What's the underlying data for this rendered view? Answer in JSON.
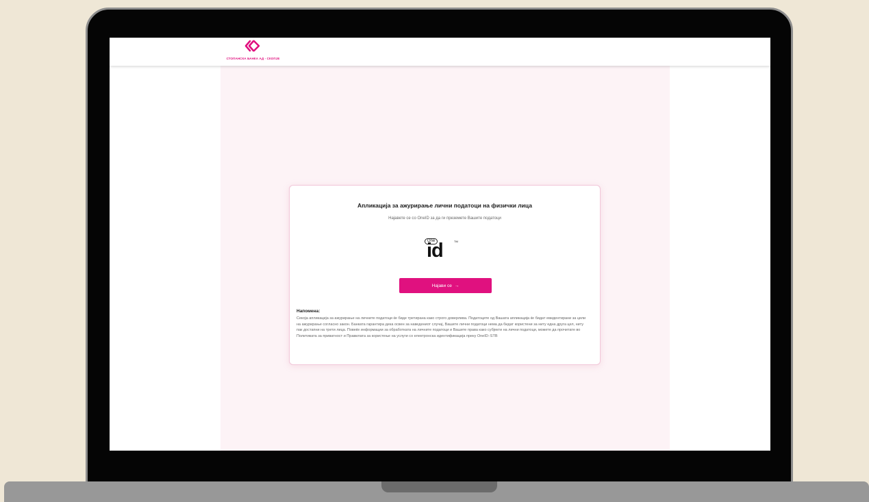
{
  "colors": {
    "brand": "#e0117f",
    "background": "#efe7d6",
    "content_background": "#fdf3f6"
  },
  "header": {
    "logo_icon": "bank-logo-icon",
    "logo_text": "СТОПАНСКА БАНКА АД - СКОПЈЕ"
  },
  "card": {
    "title": "Апликација за ажурирање лични податоци на физички лица",
    "subtitle": "Најавете се со OneID за да ги преземете Вашите податоци",
    "oneid": {
      "pill": "One",
      "id": "id",
      "tm": "TM"
    },
    "login_button": {
      "label": "Најави се",
      "icon": "arrow-right-icon",
      "arrow": "→"
    },
    "note_title": "Напомена:",
    "note_text": "Секоја апликација за ажурирање на личните податоци ќе биде третирана како строго доверлива. Податоците од Вашата апликација ќе бидат евидентирани за цели на ажурирање согласно закон. Банката гарантира дека освен за наведениот случај, Вашите лични податоци нема да бидат користени за ниту една друга цел, ниту пак достапни на трети лица. Повеќе информации за обработката на личните податоци и Вашите права како субјекти на лични податоци, можете да прочитате во Политиката за приватност и Правилата за користење на услуги со електронска идентификација преку OneID::STB"
  }
}
